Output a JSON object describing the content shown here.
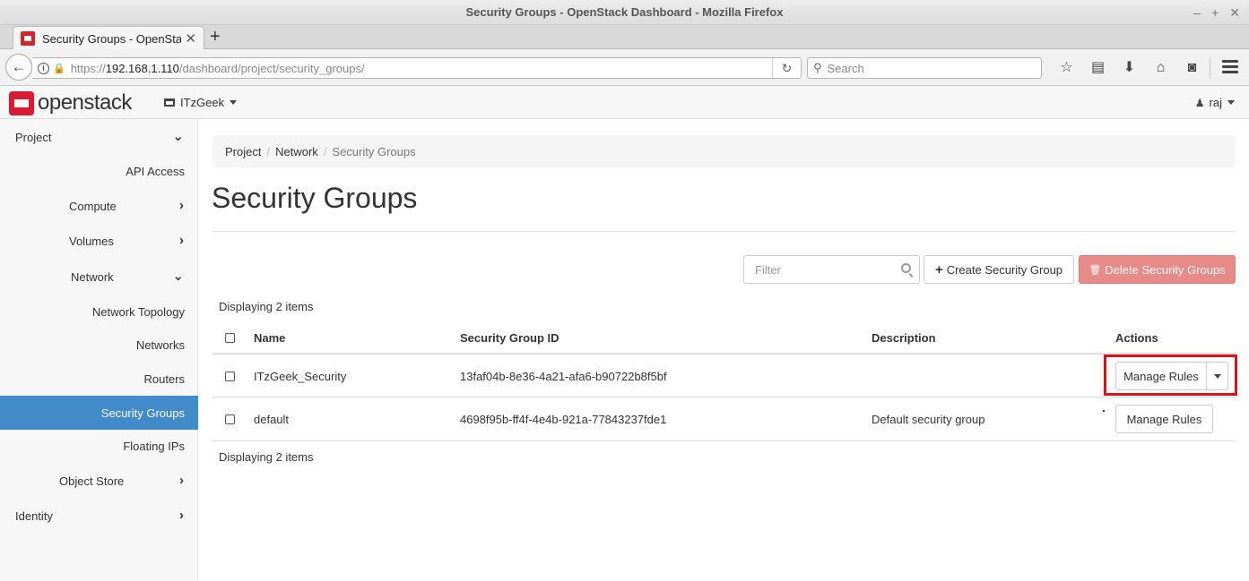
{
  "window": {
    "title": "Security Groups - OpenStack Dashboard - Mozilla Firefox",
    "controls": [
      "–",
      "+",
      "✕"
    ]
  },
  "browser": {
    "tab_title": "Security Groups - OpenStac",
    "tab_close": "✕",
    "new_tab": "+",
    "url_proto": "https://",
    "url_host": "192.168.1.110",
    "url_path": "/dashboard/project/security_groups/",
    "search_placeholder": "Search",
    "icons": {
      "bookmark": "☆",
      "reader": "▤",
      "download": "⬇",
      "home": "⌂",
      "pocket": "◙"
    }
  },
  "header": {
    "logo_text": "openstack",
    "project_name": "ITzGeek",
    "user_name": "raj"
  },
  "sidebar": {
    "items": [
      {
        "label": "Project",
        "chevron": "⌄"
      },
      {
        "label": "API Access"
      },
      {
        "label": "Compute",
        "chevron": "›"
      },
      {
        "label": "Volumes",
        "chevron": "›"
      },
      {
        "label": "Network",
        "chevron": "⌄"
      },
      {
        "label": "Network Topology"
      },
      {
        "label": "Networks"
      },
      {
        "label": "Routers"
      },
      {
        "label": "Security Groups",
        "active": true
      },
      {
        "label": "Floating IPs"
      },
      {
        "label": "Object Store",
        "chevron": "›"
      },
      {
        "label": "Identity",
        "chevron": "›"
      }
    ]
  },
  "breadcrumb": {
    "items": [
      "Project",
      "Network",
      "Security Groups"
    ],
    "separator": "/"
  },
  "page": {
    "title": "Security Groups",
    "filter_placeholder": "Filter",
    "create_label": "Create Security Group",
    "delete_label": "Delete Security Groups",
    "count_text": "Displaying 2 items",
    "accent_color": "#428bca",
    "delete_color": "#e88a87",
    "highlight_color": "#d9121c"
  },
  "table": {
    "columns": [
      "Name",
      "Security Group ID",
      "Description",
      "Actions"
    ],
    "rows": [
      {
        "name": "ITzGeek_Security",
        "id": "13faf04b-8e36-4a21-afa6-b90722b8f5bf",
        "description": "",
        "action": "Manage Rules"
      },
      {
        "name": "default",
        "id": "4698f95b-ff4f-4e4b-921a-77843237fde1",
        "description": "Default security group",
        "action": "Manage Rules"
      }
    ]
  }
}
